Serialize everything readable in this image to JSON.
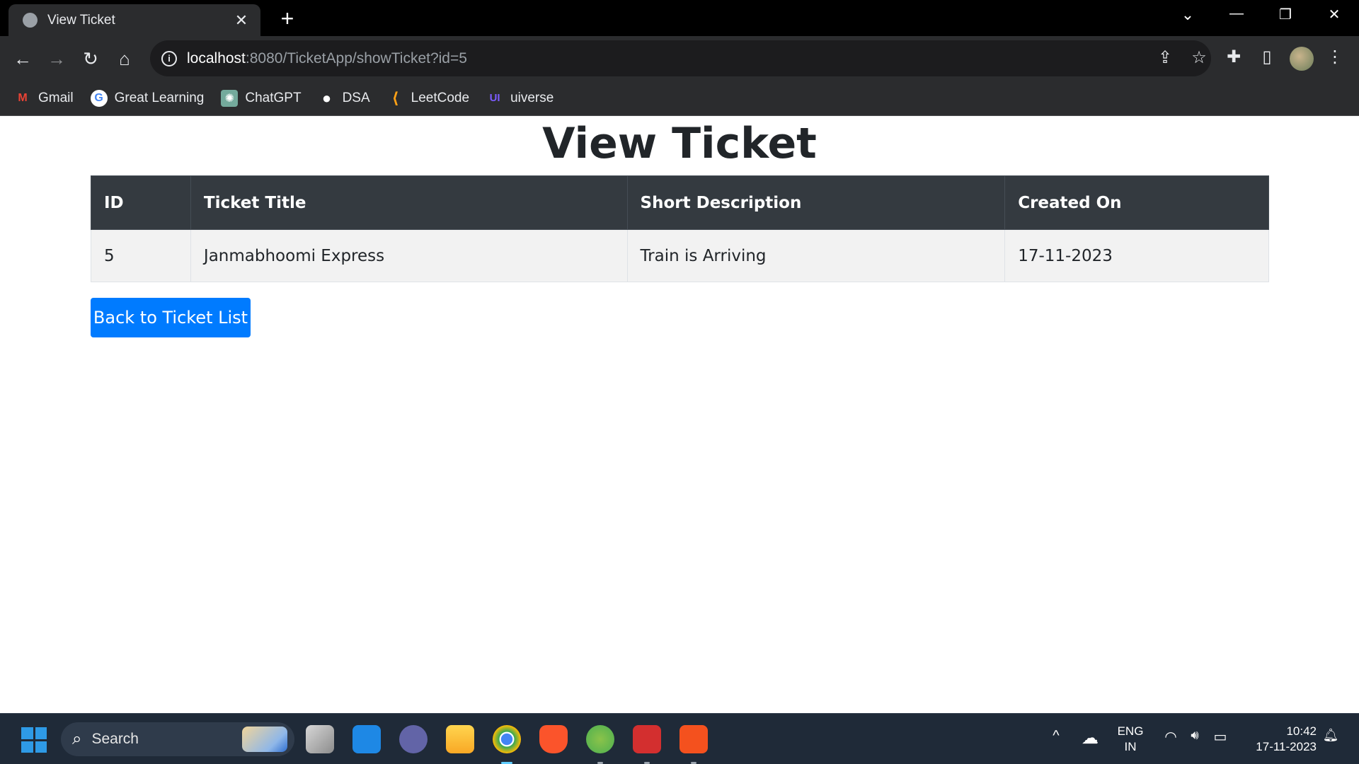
{
  "browser": {
    "tab_title": "View Ticket",
    "tab_close": "✕",
    "new_tab": "+",
    "window_controls": {
      "tab_search": "⌄",
      "minimize": "—",
      "restore": "❐",
      "close": "✕"
    },
    "nav": {
      "back": "←",
      "forward": "→",
      "reload": "↻",
      "home": "⌂"
    },
    "url_host": "localhost",
    "url_rest": ":8080/TicketApp/showTicket?id=5",
    "omnibox_icons": {
      "info": "i",
      "share": "⇪",
      "bookmark": "☆"
    },
    "toolbar_icons": {
      "extensions": "✚",
      "side_panel": "▯",
      "menu": "⋮"
    }
  },
  "bookmarks": [
    {
      "label": "Gmail",
      "icon": "M",
      "icon_name": "gmail-icon",
      "color": "#ea4335"
    },
    {
      "label": "Great Learning",
      "icon": "G",
      "icon_name": "great-learning-icon",
      "color": "#4285f4"
    },
    {
      "label": "ChatGPT",
      "icon": "✺",
      "icon_name": "chatgpt-icon",
      "color": "#74aa9c"
    },
    {
      "label": "DSA",
      "icon": "●",
      "icon_name": "github-icon",
      "color": "#ffffff"
    },
    {
      "label": "LeetCode",
      "icon": "⟨",
      "icon_name": "leetcode-icon",
      "color": "#ffa116"
    },
    {
      "label": "uiverse",
      "icon": "UI",
      "icon_name": "uiverse-icon",
      "color": "#7c5cff"
    }
  ],
  "page": {
    "title": "View Ticket",
    "table": {
      "headers": [
        "ID",
        "Ticket Title",
        "Short Description",
        "Created On"
      ],
      "rows": [
        [
          "5",
          "Janmabhoomi Express",
          "Train is Arriving",
          "17-11-2023"
        ]
      ]
    },
    "back_button": "Back to Ticket List"
  },
  "taskbar": {
    "search_label": "Search",
    "search_icon": "⌕",
    "tray_chevron": "^",
    "cloud": "☁",
    "lang_1": "ENG",
    "lang_2": "IN",
    "wifi": "◠",
    "volume": "🔊︎",
    "battery": "▭",
    "time": "10:42",
    "date": "17-11-2023",
    "bell": "🔔︎"
  },
  "colors": {
    "header_bg": "#343a40",
    "row_bg": "#f2f2f2",
    "primary": "#007bff"
  }
}
